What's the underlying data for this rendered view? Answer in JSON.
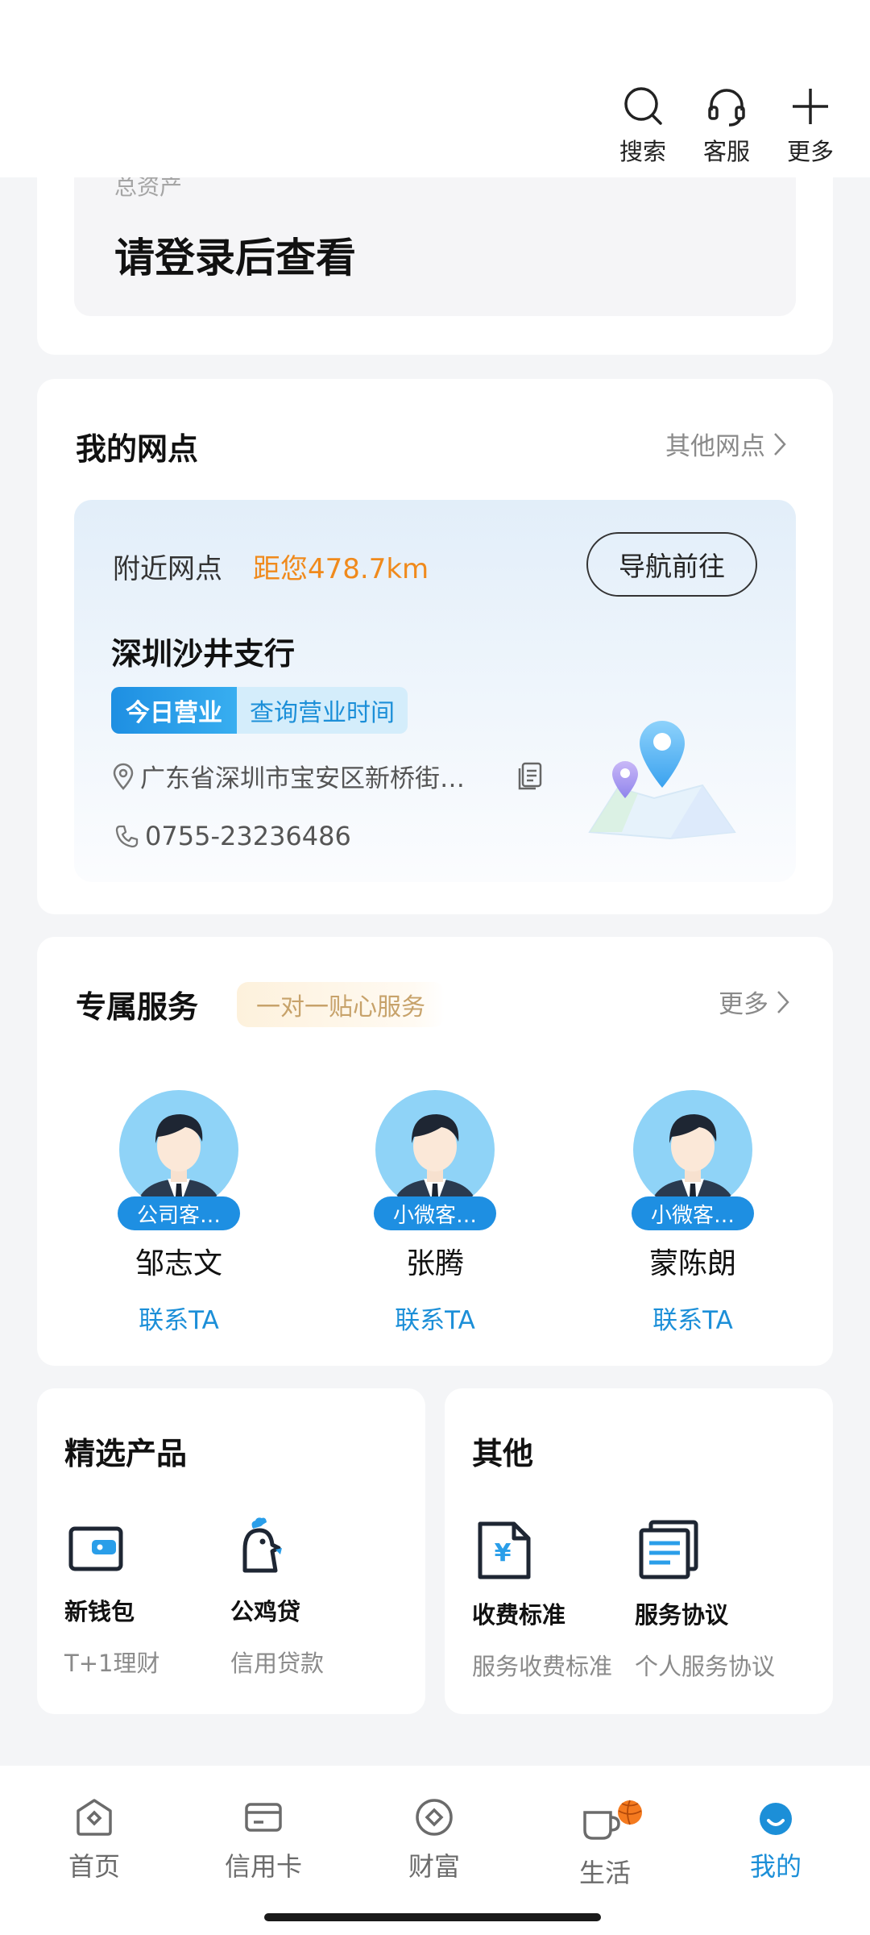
{
  "header": {
    "actions": [
      {
        "label": "搜索",
        "icon": "search-icon"
      },
      {
        "label": "客服",
        "icon": "headset-icon"
      },
      {
        "label": "更多",
        "icon": "plus-icon"
      }
    ]
  },
  "assets": {
    "label": "总资产",
    "value": "请登录后查看"
  },
  "branch": {
    "title": "我的网点",
    "other_link": "其他网点",
    "nearby_label": "附近网点",
    "distance": "距您478.7km",
    "navigate_button": "导航前往",
    "name": "深圳沙井支行",
    "tag_open": "今日营业",
    "tag_hours": "查询营业时间",
    "address": "广东省深圳市宝安区新桥街…",
    "phone": "0755-23236486"
  },
  "service": {
    "title": "专属服务",
    "slogan": "一对一贴心服务",
    "more_link": "更多",
    "advisors": [
      {
        "role": "公司客…",
        "name": "邹志文",
        "contact": "联系TA"
      },
      {
        "role": "小微客…",
        "name": "张腾",
        "contact": "联系TA"
      },
      {
        "role": "小微客…",
        "name": "蒙陈朗",
        "contact": "联系TA"
      }
    ]
  },
  "products": {
    "title": "精选产品",
    "items": [
      {
        "title": "新钱包",
        "subtitle": "T+1理财",
        "icon": "wallet-icon"
      },
      {
        "title": "公鸡贷",
        "subtitle": "信用贷款",
        "icon": "rooster-icon"
      }
    ]
  },
  "others": {
    "title": "其他",
    "items": [
      {
        "title": "收费标准",
        "subtitle": "服务收费标准",
        "icon": "fee-document-icon"
      },
      {
        "title": "服务协议",
        "subtitle": "个人服务协议",
        "icon": "agreement-icon"
      }
    ]
  },
  "tabbar": {
    "active": "我的",
    "tabs": [
      {
        "label": "首页",
        "icon": "home-icon"
      },
      {
        "label": "信用卡",
        "icon": "credit-card-icon"
      },
      {
        "label": "财富",
        "icon": "wealth-icon"
      },
      {
        "label": "生活",
        "icon": "coffee-icon"
      },
      {
        "label": "我的",
        "icon": "profile-icon"
      }
    ]
  },
  "colors": {
    "accent": "#1c8fd8",
    "distance": "#f08a1c",
    "background": "#f4f5f7"
  }
}
